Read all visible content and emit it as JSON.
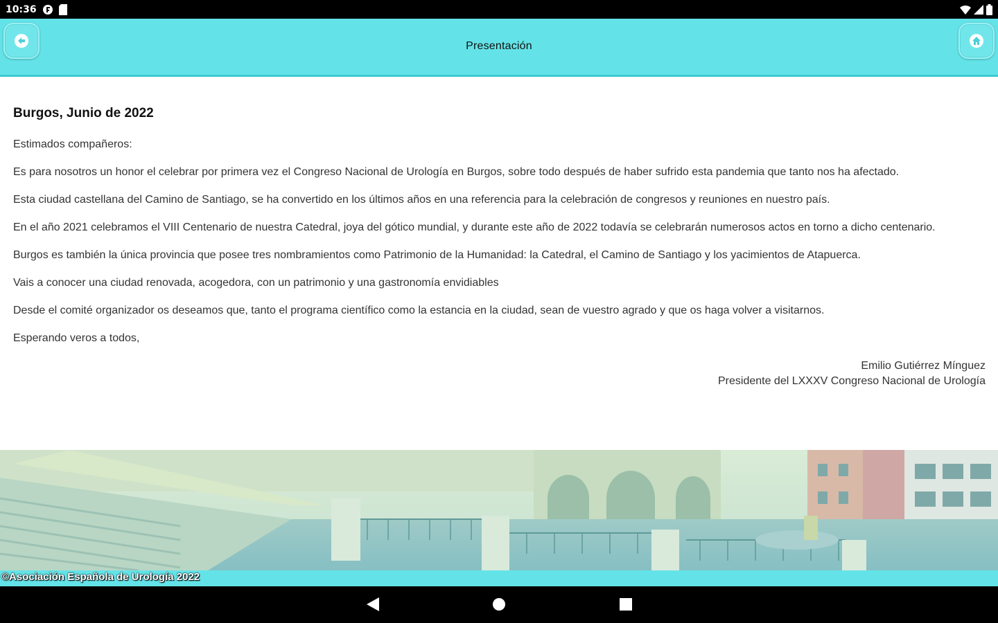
{
  "status_bar": {
    "time": "10:36",
    "icons_left": [
      "game-notification-icon",
      "sd-card-icon"
    ],
    "icons_right": [
      "wifi-icon",
      "cell-signal-icon",
      "battery-icon"
    ]
  },
  "header": {
    "title": "Presentación",
    "back_icon": "arrow-left-icon",
    "home_icon": "home-icon",
    "bg_color": "#63e3e8"
  },
  "content": {
    "heading": "Burgos, Junio de 2022",
    "paragraphs": [
      "Estimados compañeros:",
      "Es para nosotros un honor el celebrar por primera vez el Congreso Nacional de Urología en Burgos, sobre todo después de haber sufrido esta pandemia que tanto nos ha afectado.",
      "Esta ciudad castellana del Camino de Santiago, se ha convertido en los últimos años en una referencia para la celebración de congresos y reuniones en nuestro país.",
      "En el año 2021 celebramos el VIII Centenario de nuestra Catedral, joya del gótico mundial, y durante este año de 2022 todavía se celebrarán numerosos actos en torno a dicho centenario.",
      "Burgos es también la única provincia que posee tres nombramientos como Patrimonio de la Humanidad: la Catedral, el Camino de Santiago y los yacimientos de Atapuerca.",
      "Vais a conocer una ciudad renovada, acogedora, con un patrimonio y una gastronomía envidiables",
      "Desde el comité organizador os deseamos que, tanto el programa científico como la estancia en la ciudad, sean de vuestro agrado y que os haga volver a visitarnos.",
      "Esperando veros a todos,"
    ],
    "signature_name": "Emilio Gutiérrez Mínguez",
    "signature_role": "Presidente del LXXXV Congreso Nacional de Urología"
  },
  "footer": {
    "text": "©Asociación Española de Urología 2022"
  },
  "nav_bar": {
    "icons": [
      "back-triangle-icon",
      "home-circle-icon",
      "recents-square-icon"
    ]
  }
}
